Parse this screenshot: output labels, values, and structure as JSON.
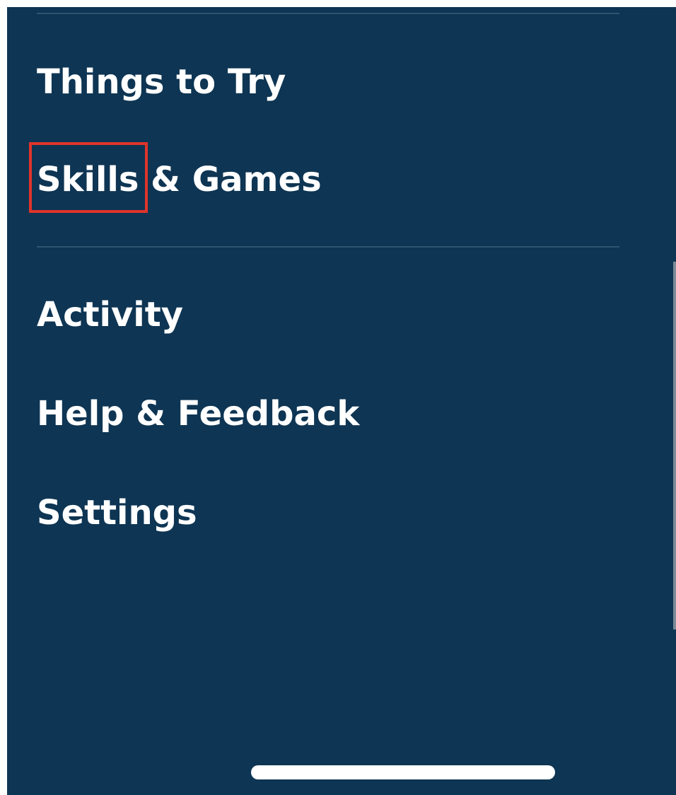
{
  "menu": {
    "items": [
      {
        "label": "Things to Try"
      },
      {
        "label_highlighted": "Skills",
        "label_rest": " & Games"
      },
      {
        "label": "Activity"
      },
      {
        "label": "Help & Feedback"
      },
      {
        "label": "Settings"
      }
    ]
  },
  "colors": {
    "background": "#0e3553",
    "text": "#ffffff",
    "highlight": "#e0342a",
    "divider": "#2f5470"
  }
}
